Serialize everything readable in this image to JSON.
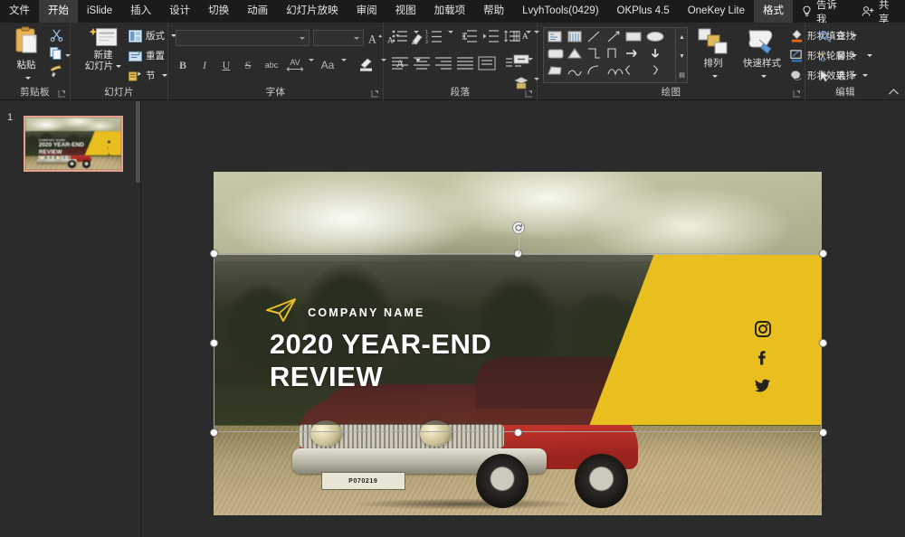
{
  "menubar": {
    "items": [
      {
        "label": "文件",
        "active": false
      },
      {
        "label": "开始",
        "active": true
      },
      {
        "label": "iSlide",
        "active": false
      },
      {
        "label": "插入",
        "active": false
      },
      {
        "label": "设计",
        "active": false
      },
      {
        "label": "切换",
        "active": false
      },
      {
        "label": "动画",
        "active": false
      },
      {
        "label": "幻灯片放映",
        "active": false
      },
      {
        "label": "审阅",
        "active": false
      },
      {
        "label": "视图",
        "active": false
      },
      {
        "label": "加载项",
        "active": false
      },
      {
        "label": "帮助",
        "active": false
      },
      {
        "label": "LvyhTools(0429)",
        "active": false
      },
      {
        "label": "OKPlus 4.5",
        "active": false
      },
      {
        "label": "OneKey Lite",
        "active": false
      },
      {
        "label": "格式",
        "active": true
      }
    ],
    "tell_me": "告诉我",
    "share": "共享"
  },
  "ribbon": {
    "groups": [
      {
        "name": "clipboard",
        "label": "剪贴板"
      },
      {
        "name": "slides",
        "label": "幻灯片"
      },
      {
        "name": "font",
        "label": "字体"
      },
      {
        "name": "paragraph",
        "label": "段落"
      },
      {
        "name": "drawing",
        "label": "绘图"
      },
      {
        "name": "editing",
        "label": "编辑"
      }
    ],
    "clipboard": {
      "paste": "粘贴",
      "cut_tip": "剪切",
      "copy_tip": "复制",
      "format_painter_tip": "格式刷"
    },
    "slides": {
      "new_slide": "新建\n幻灯片",
      "new_slide_line1": "新建",
      "new_slide_line2": "幻灯片",
      "layout": "版式",
      "reset": "重置",
      "section": "节"
    },
    "font": {
      "font_name_value": "",
      "font_size_value": "",
      "grow_font_tip": "增大字号",
      "shrink_font_tip": "减小字号",
      "clear_format_tip": "清除所有格式",
      "bold": "B",
      "italic": "I",
      "underline": "U",
      "strike": "S",
      "shadow": "abc",
      "spacing": "AV",
      "case": "Aa",
      "highlight_tip": "文本突出显示颜色",
      "font_color": "A"
    },
    "paragraph": {
      "bullets_tip": "项目符号",
      "numbering_tip": "编号",
      "decrease_indent_tip": "减少缩进量",
      "increase_indent_tip": "增加缩进量",
      "line_spacing_tip": "行距",
      "text_direction_tip": "文字方向",
      "align_text_tip": "对齐文本",
      "smartart_tip": "转换为 SmartArt"
    },
    "drawing": {
      "arrange": "排列",
      "quick_styles": "快速样式",
      "shape_fill": "形状填充",
      "shape_outline": "形状轮廓",
      "shape_effects": "形状效果"
    },
    "editing": {
      "find": "查找",
      "replace": "替换",
      "select": "选择"
    }
  },
  "sidebar": {
    "slide_number": "1"
  },
  "slide": {
    "company_name": "COMPANY NAME",
    "title_line1": "2020 YEAR-END",
    "title_line2": "REVIEW",
    "license_plate": "P070219",
    "yellow_hex": "#e8bf1f",
    "band_overlay_hex": "#262824",
    "socials": [
      {
        "name": "instagram-icon"
      },
      {
        "name": "facebook-icon"
      },
      {
        "name": "twitter-icon"
      }
    ]
  }
}
